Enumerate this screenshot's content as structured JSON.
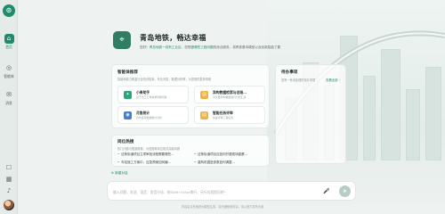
{
  "sidebar": {
    "logo": "⊙",
    "items": [
      {
        "label": "首页",
        "icon": "home-icon",
        "glyph": "⌂"
      },
      {
        "label": "智能体",
        "icon": "agent-icon",
        "glyph": "◎"
      },
      {
        "label": "消息",
        "icon": "message-icon",
        "glyph": "✉"
      }
    ],
    "bottom_icons": [
      {
        "icon": "chat-icon",
        "glyph": "☐"
      },
      {
        "icon": "grid-icon",
        "glyph": "▦"
      },
      {
        "icon": "bell-icon",
        "glyph": "♪"
      }
    ]
  },
  "hero": {
    "badge_glyph": "⌖",
    "title": "青岛地铁，畅达幸福",
    "subtitle_pre": "您好！",
    "subtitle_hl1": "青岛地铁一线有工业区",
    "subtitle_mid": "，您想",
    "subtitle_hl2": "做哪些工程问题",
    "subtitle_post": "的综合服务，将青铁基本模型以及创新智能了要"
  },
  "agents_panel": {
    "title": "智能体推荐",
    "desc": "智能体能力覆盖行业知识检索、专业问答、数据分析等，为您提供更多帮助",
    "cards": [
      {
        "title": "小青助手",
        "desc": "基于员工工作需求智能问答",
        "color": "#2fa37a",
        "glyph": "✦"
      },
      {
        "title": "异构数据检索与总结…",
        "desc": "对大量异构数据进行分析汇总",
        "color": "#f0b344",
        "glyph": "▤"
      },
      {
        "title": "月售统计",
        "desc": "月均运营数据统计分析",
        "color": "#3f7fd6",
        "glyph": "◉"
      },
      {
        "title": "智能任务评审",
        "desc": "快速评审工程任务",
        "color": "#f0b344",
        "glyph": "▤"
      }
    ]
  },
  "todo_panel": {
    "title": "待办事项",
    "desc": "您有一条未处理的待办事项",
    "link": "查看全部 ›"
  },
  "questions_panel": {
    "title": "岗位热搜",
    "desc": "热门问题与搜索推荐，为您推荐岗位相关高频问题",
    "items": [
      "这条街道项目立项审批流程需要哪些…",
      "这条街道项目应如何开展现场勘察…",
      "车站施工方案中，应急预案如何编…",
      "盾构机掘进参数如何调整…"
    ]
  },
  "chat": {
    "new_chat": "⊕ 新建对话",
    "placeholder": "输入问题，发送、语音、发音分化、按Shift+Enter换行、另行向我提问吧~",
    "mic_glyph": "🎤",
    "send_glyph": "➤",
    "footer": "内容由青岛地铁大模型生成，请仔细甄别内容，请以官方发布为准"
  }
}
